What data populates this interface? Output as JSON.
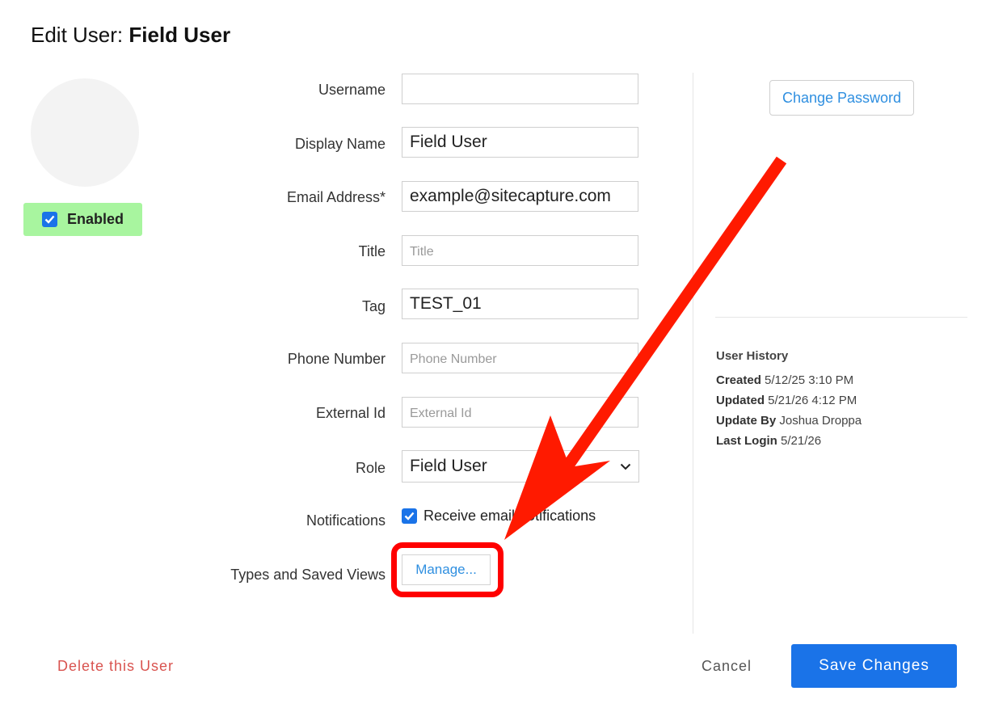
{
  "header": {
    "title_prefix": "Edit User: ",
    "title_name": "Field User"
  },
  "profile": {
    "enabled_label": "Enabled",
    "enabled": true
  },
  "form": {
    "username": {
      "label": "Username",
      "value": ""
    },
    "display_name": {
      "label": "Display Name",
      "value": "Field User"
    },
    "email": {
      "label": "Email Address*",
      "value": "example@sitecapture.com"
    },
    "title": {
      "label": "Title",
      "value": "",
      "placeholder": "Title"
    },
    "tag": {
      "label": "Tag",
      "value": "TEST_01"
    },
    "phone": {
      "label": "Phone Number",
      "value": "",
      "placeholder": "Phone Number"
    },
    "external_id": {
      "label": "External Id",
      "value": "",
      "placeholder": "External Id"
    },
    "role": {
      "label": "Role",
      "value": "Field User"
    },
    "notifications": {
      "label": "Notifications",
      "checkbox_label": "Receive email notifications",
      "checked": true
    },
    "types_views": {
      "label": "Types and Saved Views",
      "button": "Manage..."
    }
  },
  "sidebar": {
    "change_password": "Change Password",
    "history": {
      "heading": "User History",
      "created_label": "Created",
      "created_value": "5/12/25 3:10 PM",
      "updated_label": "Updated",
      "updated_value": "5/21/26 4:12 PM",
      "updated_by_label": "Update By",
      "updated_by_value": "Joshua Droppa",
      "last_login_label": "Last Login",
      "last_login_value": "5/21/26"
    }
  },
  "footer": {
    "delete": "Delete this User",
    "cancel": "Cancel",
    "save": "Save Changes"
  },
  "colors": {
    "accent": "#1a73e8",
    "enabled_bg": "#a8f59f",
    "danger": "#d9534f",
    "annotation": "#ff0000"
  }
}
